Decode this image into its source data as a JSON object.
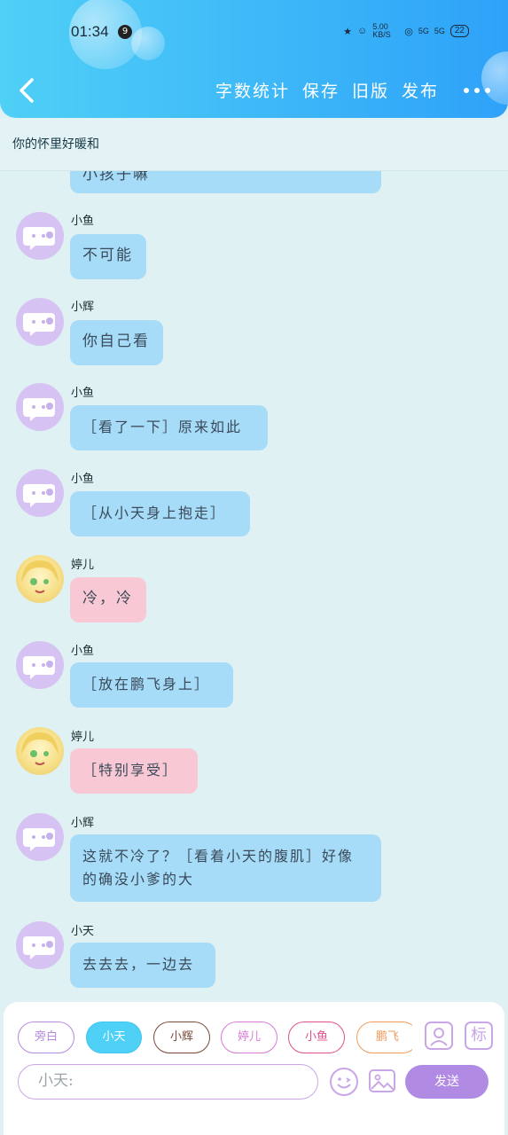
{
  "status_bar": {
    "time": "01:34",
    "notification_count": "9",
    "net_speed": "5.00 KB/S",
    "signal_1": "5G",
    "signal_2": "5G",
    "battery": "22"
  },
  "toolbar": {
    "word_count": "字数统计",
    "save": "保存",
    "old_version": "旧版",
    "publish": "发布"
  },
  "subtitle": "你的怀里好暖和",
  "messages": [
    {
      "sender": "",
      "text": "小孩子嘛",
      "style": "blue",
      "avatar": "default-avatar-icon"
    },
    {
      "sender": "小鱼",
      "text": "不可能",
      "style": "blue",
      "avatar": "default-avatar-icon"
    },
    {
      "sender": "小辉",
      "text": "你自己看",
      "style": "blue",
      "avatar": "default-avatar-icon"
    },
    {
      "sender": "小鱼",
      "text": "［看了一下］原来如此",
      "style": "blue",
      "avatar": "default-avatar-icon"
    },
    {
      "sender": "小鱼",
      "text": "［从小天身上抱走］",
      "style": "blue",
      "avatar": "default-avatar-icon"
    },
    {
      "sender": "婷儿",
      "text": "冷，冷",
      "style": "pink",
      "avatar": "anime-girl-avatar-icon"
    },
    {
      "sender": "小鱼",
      "text": "［放在鹏飞身上］",
      "style": "blue",
      "avatar": "default-avatar-icon"
    },
    {
      "sender": "婷儿",
      "text": "［特别享受］",
      "style": "pink",
      "avatar": "anime-girl-avatar-icon"
    },
    {
      "sender": "小辉",
      "text": "这就不冷了？［看着小天的腹肌］好像的确没小爹的大",
      "style": "blue",
      "avatar": "default-avatar-icon"
    },
    {
      "sender": "小天",
      "text": "去去去，一边去",
      "style": "blue",
      "avatar": "default-avatar-icon"
    }
  ],
  "roles": [
    {
      "label": "旁白",
      "color": "#b58be0",
      "active": false
    },
    {
      "label": "小天",
      "color": "#3fc6ef",
      "active": true
    },
    {
      "label": "小辉",
      "color": "#7a4a3a",
      "active": false
    },
    {
      "label": "婷儿",
      "color": "#d87ad6",
      "active": false
    },
    {
      "label": "小鱼",
      "color": "#e0508a",
      "active": false
    },
    {
      "label": "鹏飞",
      "color": "#f09a5a",
      "active": false
    }
  ],
  "side_icons": {
    "character": "character-manage-icon",
    "mark": "标"
  },
  "input": {
    "prefix": "小天:"
  },
  "send_label": "发送",
  "colors": {
    "header_start": "#4fd0f6",
    "header_end": "#2ea2f9",
    "bubble_blue": "#a6dcf8",
    "bubble_pink": "#f8c8d4",
    "accent_purple": "#b18ae4"
  }
}
